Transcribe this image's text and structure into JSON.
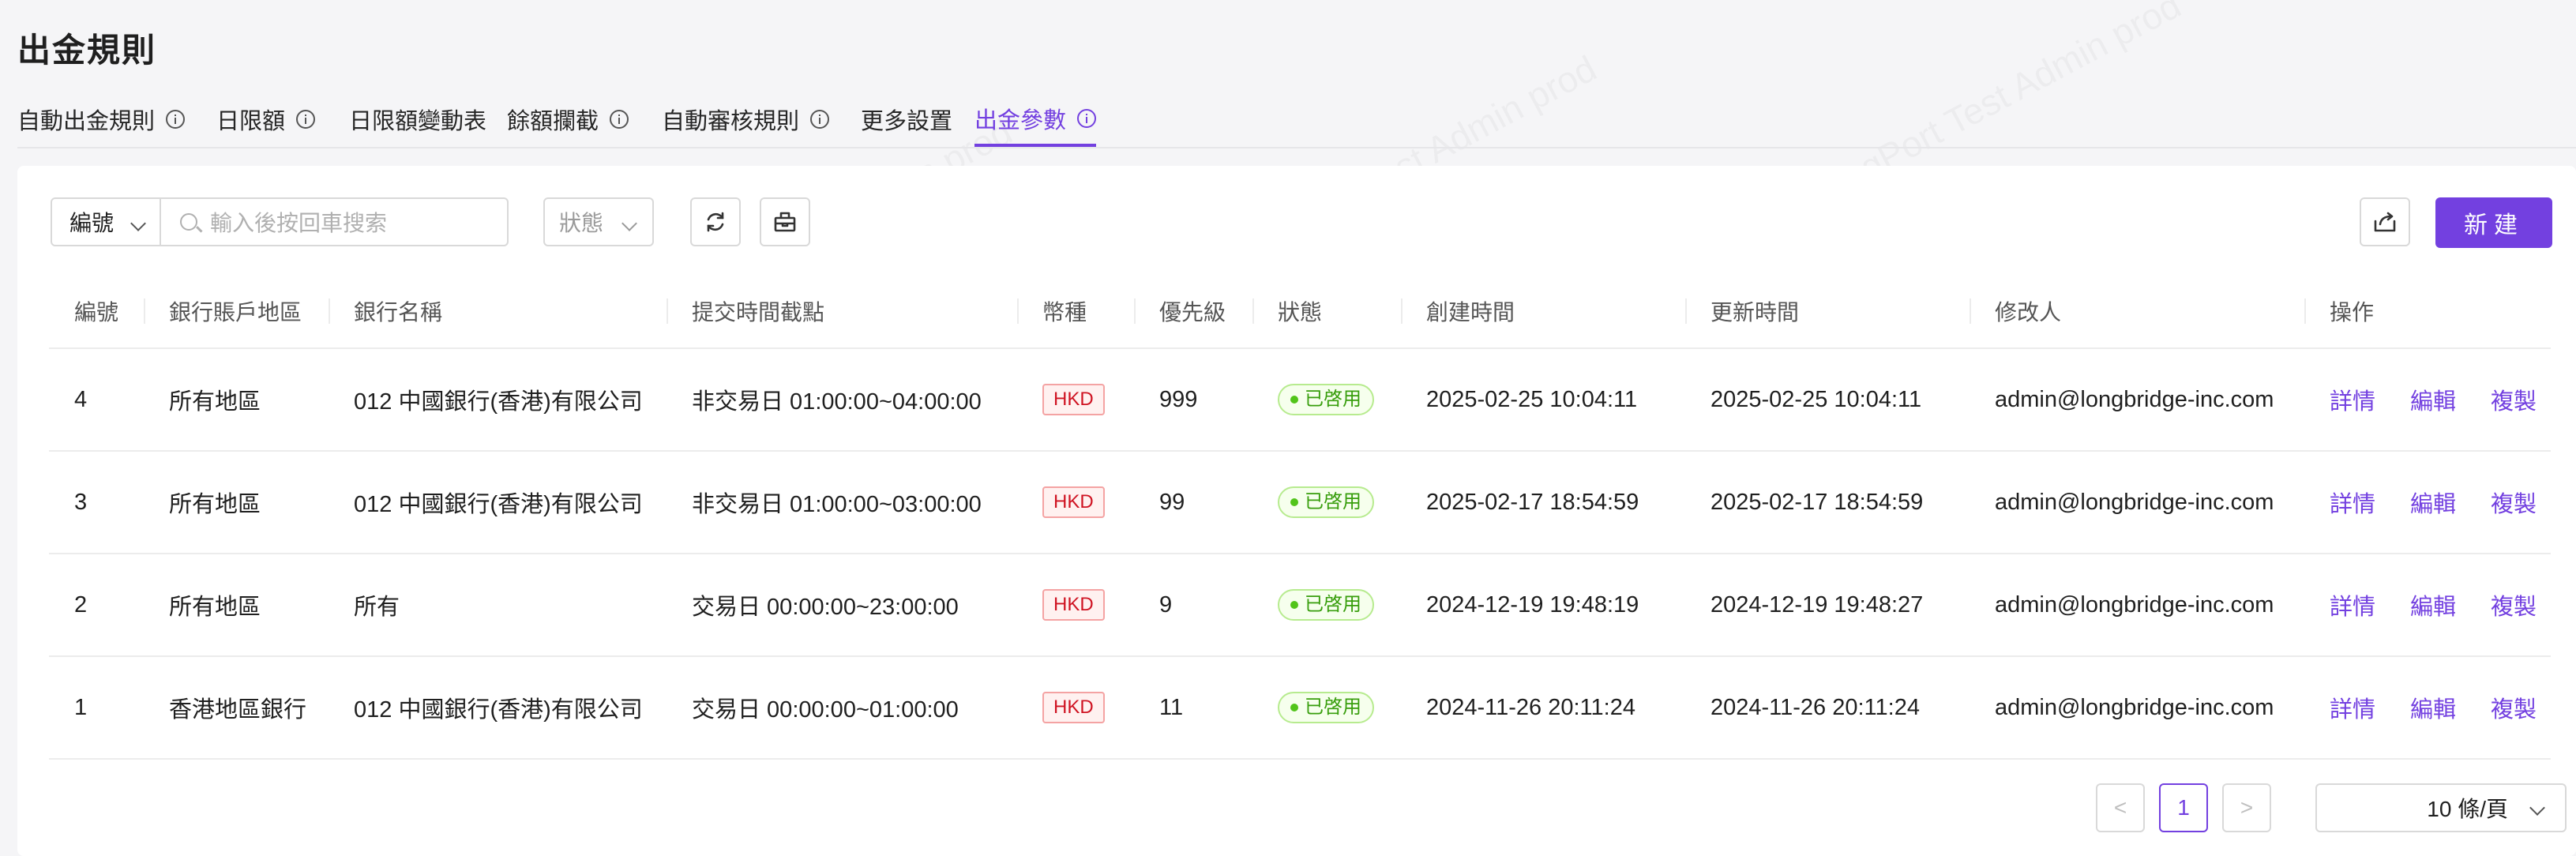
{
  "page_title": "出金規則",
  "tabs": [
    {
      "label": "自動出金規則",
      "info": true
    },
    {
      "label": "日限額",
      "info": true
    },
    {
      "label": "日限額變動表",
      "info": false
    },
    {
      "label": "餘額攔截",
      "info": true
    },
    {
      "label": "自動審核規則",
      "info": true
    },
    {
      "label": "更多設置",
      "info": false
    },
    {
      "label": "出金參數",
      "info": true,
      "active": true
    }
  ],
  "toolbar": {
    "field_select": "編號",
    "search_placeholder": "輸入後按回車搜索",
    "status_placeholder": "狀態",
    "new_label": "新建",
    "icons": [
      "refresh-icon",
      "clear-basket-icon",
      "export-icon"
    ]
  },
  "table": {
    "columns": [
      "編號",
      "銀行賬戶地區",
      "銀行名稱",
      "提交時間截點",
      "幣種",
      "優先級",
      "狀態",
      "創建時間",
      "更新時間",
      "修改人",
      "操作"
    ],
    "rows": [
      {
        "id": "4",
        "region": "所有地區",
        "bank": "012 中國銀行(香港)有限公司",
        "cutoff": "非交易日 01:00:00~04:00:00",
        "currency": "HKD",
        "priority": "999",
        "status": "已啓用",
        "created": "2025-02-25 10:04:11",
        "updated": "2025-02-25 10:04:11",
        "modifier": "admin@longbridge-inc.com"
      },
      {
        "id": "3",
        "region": "所有地區",
        "bank": "012 中國銀行(香港)有限公司",
        "cutoff": "非交易日 01:00:00~03:00:00",
        "currency": "HKD",
        "priority": "99",
        "status": "已啓用",
        "created": "2025-02-17 18:54:59",
        "updated": "2025-02-17 18:54:59",
        "modifier": "admin@longbridge-inc.com"
      },
      {
        "id": "2",
        "region": "所有地區",
        "bank": "所有",
        "cutoff": "交易日 00:00:00~23:00:00",
        "currency": "HKD",
        "priority": "9",
        "status": "已啓用",
        "created": "2024-12-19 19:48:19",
        "updated": "2024-12-19 19:48:27",
        "modifier": "admin@longbridge-inc.com"
      },
      {
        "id": "1",
        "region": "香港地區銀行",
        "bank": "012 中國銀行(香港)有限公司",
        "cutoff": "交易日 00:00:00~01:00:00",
        "currency": "HKD",
        "priority": "11",
        "status": "已啓用",
        "created": "2024-11-26 20:11:24",
        "updated": "2024-11-26 20:11:24",
        "modifier": "admin@longbridge-inc.com"
      }
    ],
    "actions": [
      "詳情",
      "編輯",
      "複製"
    ]
  },
  "pagination": {
    "prev": "<",
    "current": "1",
    "next": ">",
    "page_size": "10 條/頁"
  },
  "watermark": "LongPort Test Admin prod",
  "colors": {
    "accent": "#7340e0",
    "tag_red": "#cf1322",
    "tag_green": "#389e0d"
  }
}
